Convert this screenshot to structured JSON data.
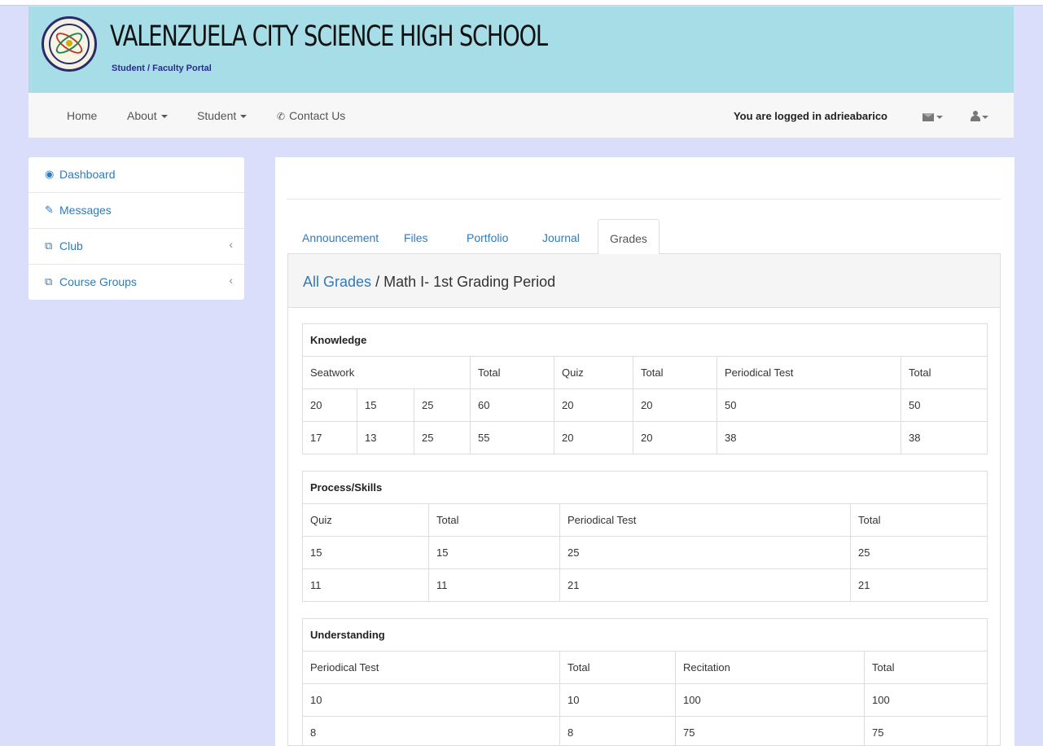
{
  "header": {
    "school_name": "VALENZUELA CITY SCIENCE HIGH SCHOOL",
    "subtitle": "Student / Faculty Portal"
  },
  "navbar": {
    "items": [
      {
        "label": "Home"
      },
      {
        "label": "About"
      },
      {
        "label": "Student"
      },
      {
        "label": "Contact Us"
      }
    ],
    "logged_in_text": "You are logged in adrieabarico"
  },
  "sidebar": {
    "items": [
      {
        "label": "Dashboard"
      },
      {
        "label": "Messages"
      },
      {
        "label": "Club"
      },
      {
        "label": "Course Groups"
      }
    ]
  },
  "tabs": [
    {
      "label": "Announcement"
    },
    {
      "label": "Files"
    },
    {
      "label": "Portfolio"
    },
    {
      "label": "Journal"
    },
    {
      "label": "Grades",
      "active": true
    }
  ],
  "panel": {
    "link": "All Grades",
    "separator": "/",
    "title": "Math I- 1st Grading Period"
  },
  "knowledge": {
    "title": "Knowledge",
    "headers": [
      "Seatwork",
      "Total",
      "Quiz",
      "Total",
      "Periodical Test",
      "Total"
    ],
    "rows": [
      [
        "20",
        "15",
        "25",
        "60",
        "20",
        "20",
        "50",
        "50"
      ],
      [
        "17",
        "13",
        "25",
        "55",
        "20",
        "20",
        "38",
        "38"
      ]
    ]
  },
  "process": {
    "title": "Process/Skills",
    "headers": [
      "Quiz",
      "Total",
      "Periodical Test",
      "Total"
    ],
    "rows": [
      [
        "15",
        "15",
        "25",
        "25"
      ],
      [
        "11",
        "11",
        "21",
        "21"
      ]
    ]
  },
  "understanding": {
    "title": "Understanding",
    "headers": [
      "Periodical Test",
      "Total",
      "Recitation",
      "Total"
    ],
    "rows": [
      [
        "10",
        "10",
        "100",
        "100"
      ],
      [
        "8",
        "8",
        "75",
        "75"
      ]
    ]
  },
  "colors": {
    "banner": "#a6dde6",
    "background": "#dadefa",
    "link": "#337ab7"
  }
}
